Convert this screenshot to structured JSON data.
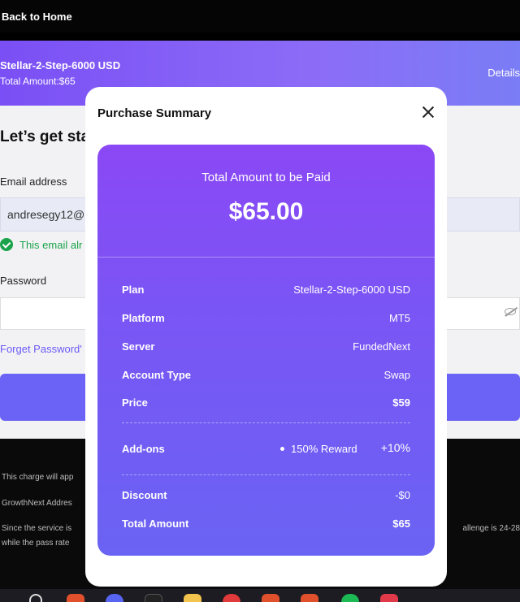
{
  "topbar": {
    "back_label": "Back to Home"
  },
  "plan_bar": {
    "name": "Stellar-2-Step-6000 USD",
    "total": "Total Amount:$65",
    "details_label": "Details"
  },
  "form": {
    "title": "Let’s get sta",
    "email_label": "Email address",
    "email_value": "andresegy12@",
    "email_status": "This email alr",
    "password_label": "Password",
    "forgot_label": "Forget Password'"
  },
  "footer_text": {
    "line1": "This charge will app",
    "line2": "GrowthNext Addres",
    "line3": "Since the service is",
    "line3_right": "allenge is 24-28",
    "line4": "while the pass rate"
  },
  "modal": {
    "title": "Purchase Summary",
    "amount_label": "Total Amount to be Paid",
    "amount_value": "$65.00",
    "rows": [
      {
        "key": "Plan",
        "value": "Stellar-2-Step-6000 USD"
      },
      {
        "key": "Platform",
        "value": "MT5"
      },
      {
        "key": "Server",
        "value": "FundedNext"
      },
      {
        "key": "Account Type",
        "value": "Swap"
      },
      {
        "key": "Price",
        "value": "$59"
      }
    ],
    "addons": {
      "key": "Add-ons",
      "item": "150% Reward",
      "percent": "+10%"
    },
    "discount": {
      "key": "Discount",
      "value": "-$0"
    },
    "total": {
      "key": "Total Amount",
      "value": "$65"
    }
  },
  "colors": {
    "accent": "#6a63f5",
    "card_top": "#8b48f5",
    "card_bottom": "#6a63f3",
    "success": "#1aa34a"
  },
  "taskbar": {
    "icons": [
      "app-icon-red",
      "search-icon",
      "discord-icon",
      "epic-icon",
      "folder-icon",
      "chrome-icon",
      "app-icon-red",
      "app-icon-red",
      "spotify-icon",
      "app-icon-red"
    ]
  }
}
